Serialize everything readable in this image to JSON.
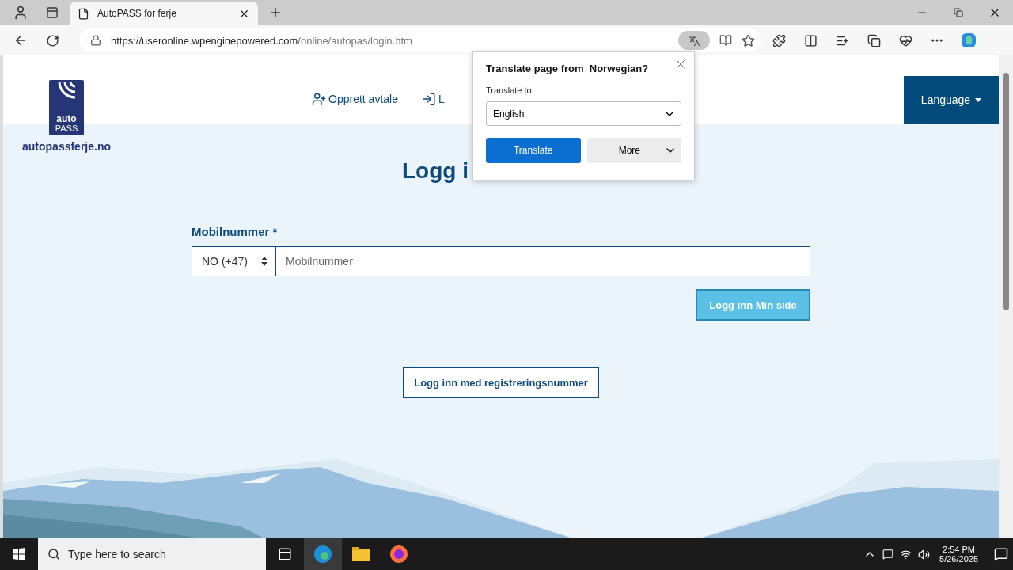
{
  "browser": {
    "tab": {
      "title": "AutoPASS for ferje",
      "selected": true
    },
    "url": {
      "host": "https://useronline.wpenginepowered.com",
      "path": "/online/autopas/login.htm"
    }
  },
  "site": {
    "logo": {
      "top": "auto",
      "bottom": "PASS",
      "domain": "autopassferje.no"
    },
    "nav": [
      {
        "label": "Opprett avtale",
        "kind": "user-add"
      },
      {
        "label": "L",
        "kind": "login"
      }
    ],
    "language_button": "Language"
  },
  "login": {
    "title": "Logg i",
    "field_label": "Mobilnummer *",
    "country": "NO (+47)",
    "phone": {
      "placeholder": "Mobilnummer"
    },
    "submit": "Logg inn Min side",
    "alt_button": "Logg inn med registreringsnummer"
  },
  "translate_popup": {
    "title": "Translate page from  Norwegian?",
    "label": "Translate to",
    "language": "English",
    "translate": "Translate",
    "more": "More"
  },
  "taskbar": {
    "search_placeholder": "Type here to search",
    "time": "2:54 PM",
    "date": "5/26/2025"
  }
}
